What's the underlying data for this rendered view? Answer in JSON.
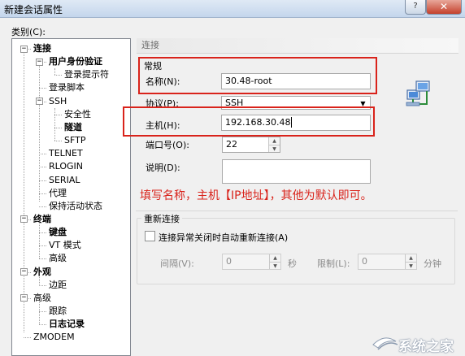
{
  "window": {
    "title": "新建会话属性",
    "help_button": "?",
    "close_button": "✕"
  },
  "category_label": "类别(C):",
  "tree": [
    {
      "label": "连接",
      "level": 0,
      "bold": true,
      "expander": "−"
    },
    {
      "label": "用户身份验证",
      "level": 1,
      "bold": true,
      "expander": "−"
    },
    {
      "label": "登录提示符",
      "level": 2,
      "bold": false
    },
    {
      "label": "登录脚本",
      "level": 1,
      "bold": false
    },
    {
      "label": "SSH",
      "level": 1,
      "bold": false,
      "expander": "−"
    },
    {
      "label": "安全性",
      "level": 2,
      "bold": false
    },
    {
      "label": "隧道",
      "level": 2,
      "bold": true
    },
    {
      "label": "SFTP",
      "level": 2,
      "bold": false
    },
    {
      "label": "TELNET",
      "level": 1,
      "bold": false
    },
    {
      "label": "RLOGIN",
      "level": 1,
      "bold": false
    },
    {
      "label": "SERIAL",
      "level": 1,
      "bold": false
    },
    {
      "label": "代理",
      "level": 1,
      "bold": false
    },
    {
      "label": "保持活动状态",
      "level": 1,
      "bold": false
    },
    {
      "label": "终端",
      "level": 0,
      "bold": true,
      "expander": "−"
    },
    {
      "label": "键盘",
      "level": 1,
      "bold": true
    },
    {
      "label": "VT 模式",
      "level": 1,
      "bold": false
    },
    {
      "label": "高级",
      "level": 1,
      "bold": false
    },
    {
      "label": "外观",
      "level": 0,
      "bold": true,
      "expander": "−"
    },
    {
      "label": "边距",
      "level": 1,
      "bold": false
    },
    {
      "label": "高级",
      "level": 0,
      "bold": false,
      "expander": "−"
    },
    {
      "label": "跟踪",
      "level": 1,
      "bold": false
    },
    {
      "label": "日志记录",
      "level": 1,
      "bold": true
    },
    {
      "label": "ZMODEM",
      "level": 0,
      "bold": false
    }
  ],
  "panel": {
    "section_header": "连接",
    "general_group": "常规",
    "name_label": "名称(N):",
    "name_value": "30.48-root",
    "protocol_label": "协议(P):",
    "protocol_value": "SSH",
    "host_label": "主机(H):",
    "host_value": "192.168.30.48",
    "port_label": "端口号(O):",
    "port_value": "22",
    "description_label": "说明(D):",
    "description_value": "",
    "annotation": "填写名称，主机【IP地址】，其他为默认即可。",
    "reconnect": {
      "title": "重新连接",
      "auto_reconnect_label": "连接异常关闭时自动重新连接(A)",
      "interval_label": "间隔(V):",
      "interval_value": "0",
      "interval_unit": "秒",
      "limit_label": "限制(L):",
      "limit_value": "0",
      "limit_unit": "分钟"
    }
  },
  "watermark": "系统之家",
  "colors": {
    "highlight_box": "#d9231b",
    "annotation_text": "#d9231b"
  }
}
